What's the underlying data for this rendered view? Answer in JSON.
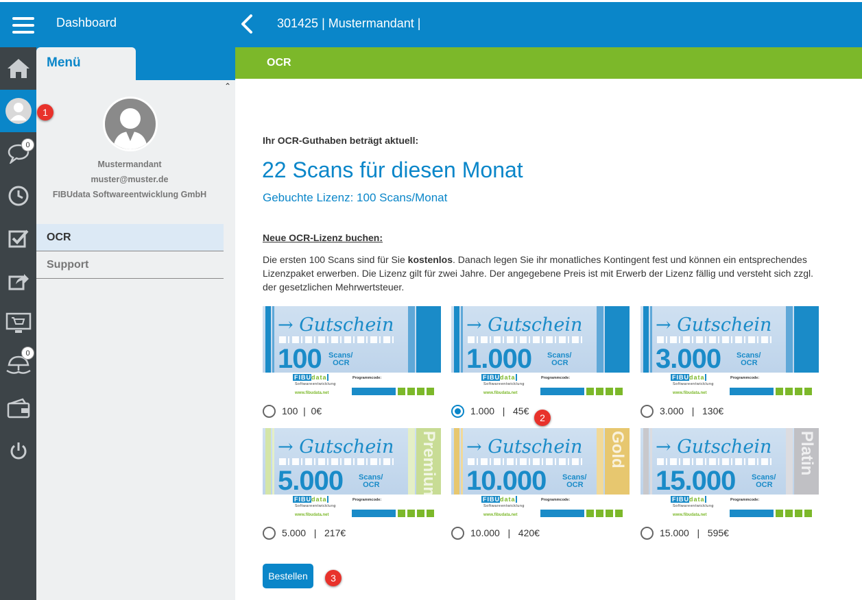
{
  "header": {
    "title": "Dashboard",
    "client": "301425 | Mustermandant |"
  },
  "rail": {
    "chat_badge": "0",
    "insurance_badge": "0"
  },
  "menu": {
    "tab_label": "Menü",
    "profile": {
      "name": "Mustermandant",
      "email": "muster@muster.de",
      "company": "FIBUdata Softwareentwicklung GmbH"
    },
    "items": [
      {
        "label": "OCR"
      },
      {
        "label": "Support"
      }
    ]
  },
  "section": {
    "title": "OCR"
  },
  "credit": {
    "label": "Ihr OCR-Guthaben beträgt aktuell:",
    "amount": "22 Scans für diesen Monat",
    "license": "Gebuchte Lizenz: 100 Scans/Monat"
  },
  "new_license": {
    "heading": "Neue OCR-Lizenz buchen:",
    "desc_pre": "Die ersten 100 Scans sind für Sie ",
    "desc_bold": "kostenlos",
    "desc_post": ". Danach legen Sie ihr monatliches Kontingent fest und können ein entsprechendes Lizenzpaket erwerben. Die Lizenz gilt für zwei Jahre. Der angegebene Preis ist mit Erwerb der Lizenz fällig und versteht sich zzgl. der gesetzlichen Mehrwertsteuer."
  },
  "voucher_text": {
    "gutschein": "→ Gutschein",
    "unit_line1": "Scans/",
    "unit_line2": "OCR",
    "logo_a": "FIBU",
    "logo_b": "data",
    "logo_sub": "Softwareentwicklung",
    "url": "www.fibudata.net",
    "program_code": "Programmcode:"
  },
  "packages": [
    {
      "amount": "100",
      "option": "100  |  0€",
      "tier": "",
      "selected": false
    },
    {
      "amount": "1.000",
      "option": "1.000   |   45€",
      "tier": "",
      "selected": true
    },
    {
      "amount": "3.000",
      "option": "3.000   |   130€",
      "tier": "",
      "selected": false
    },
    {
      "amount": "5.000",
      "option": "5.000   |   217€",
      "tier": "Premium",
      "selected": false
    },
    {
      "amount": "10.000",
      "option": "10.000   |   420€",
      "tier": "Gold",
      "selected": false
    },
    {
      "amount": "15.000",
      "option": "15.000   |   595€",
      "tier": "Platin",
      "selected": false
    }
  ],
  "order_button": "Bestellen",
  "markers": [
    "1",
    "2",
    "3"
  ],
  "colors": {
    "brand_blue": "#0a86c9",
    "brand_green": "#7cb82a",
    "rail": "#3d4448",
    "marker_red": "#e8322b"
  }
}
